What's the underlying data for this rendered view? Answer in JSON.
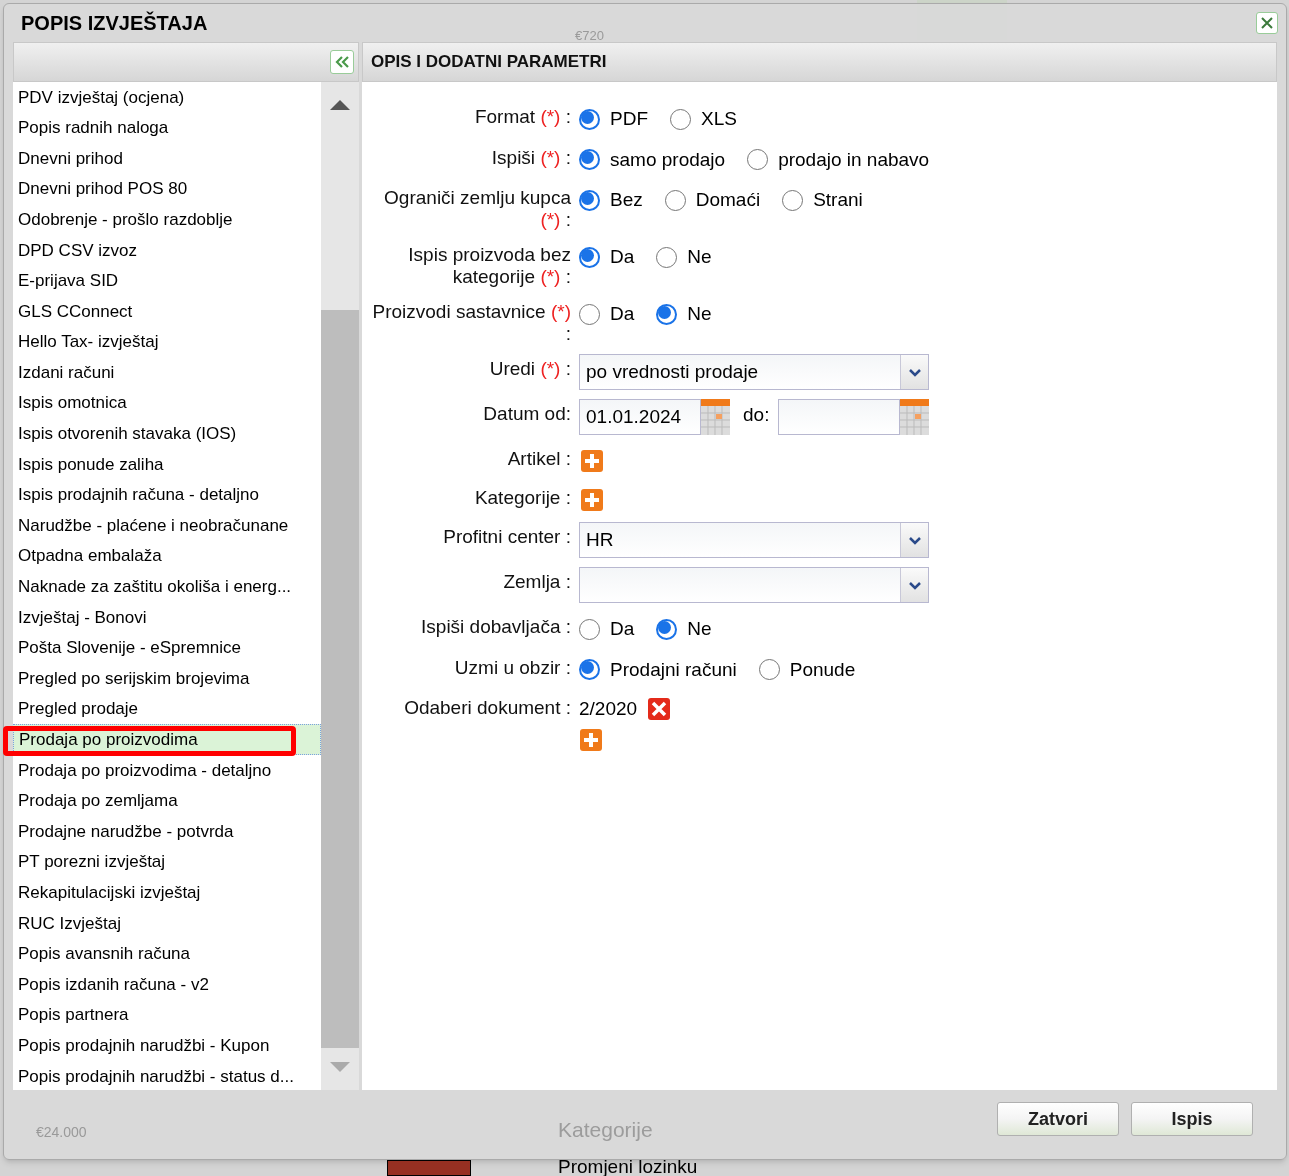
{
  "backdrop": {
    "top_value": "€720",
    "axis_label": "€24.000",
    "menu_items": [
      "Kategorije",
      "Promjeni lozinku"
    ]
  },
  "dialog": {
    "title": "POPIS IZVJEŠTAJA",
    "panel_title": "OPIS I DODATNI PARAMETRI"
  },
  "reports": [
    {
      "label": "PDV izvještaj (ocjena)",
      "selected": false,
      "annotated": false
    },
    {
      "label": "Popis radnih naloga",
      "selected": false,
      "annotated": false
    },
    {
      "label": "Dnevni prihod",
      "selected": false,
      "annotated": false
    },
    {
      "label": "Dnevni prihod POS 80",
      "selected": false,
      "annotated": false
    },
    {
      "label": "Odobrenje - prošlo razdoblje",
      "selected": false,
      "annotated": false
    },
    {
      "label": "DPD CSV izvoz",
      "selected": false,
      "annotated": false
    },
    {
      "label": "E-prijava SID",
      "selected": false,
      "annotated": false
    },
    {
      "label": "GLS CConnect",
      "selected": false,
      "annotated": false
    },
    {
      "label": "Hello Tax- izvještaj",
      "selected": false,
      "annotated": false
    },
    {
      "label": "Izdani računi",
      "selected": false,
      "annotated": false
    },
    {
      "label": "Ispis omotnica",
      "selected": false,
      "annotated": false
    },
    {
      "label": "Ispis otvorenih stavaka (IOS)",
      "selected": false,
      "annotated": false
    },
    {
      "label": "Ispis ponude zaliha",
      "selected": false,
      "annotated": false
    },
    {
      "label": "Ispis prodajnih računa - detaljno",
      "selected": false,
      "annotated": false
    },
    {
      "label": "Narudžbe - plaćene i neobračunane",
      "selected": false,
      "annotated": false
    },
    {
      "label": "Otpadna embalaža",
      "selected": false,
      "annotated": false
    },
    {
      "label": "Naknade za zaštitu okoliša i energ...",
      "selected": false,
      "annotated": false
    },
    {
      "label": "Izvještaj - Bonovi",
      "selected": false,
      "annotated": false
    },
    {
      "label": "Pošta Slovenije - eSpremnice",
      "selected": false,
      "annotated": false
    },
    {
      "label": "Pregled po serijskim brojevima",
      "selected": false,
      "annotated": false
    },
    {
      "label": "Pregled prodaje",
      "selected": false,
      "annotated": false
    },
    {
      "label": "Prodaja po proizvodima",
      "selected": true,
      "annotated": true
    },
    {
      "label": "Prodaja po proizvodima - detaljno",
      "selected": false,
      "annotated": false
    },
    {
      "label": "Prodaja po zemljama",
      "selected": false,
      "annotated": false
    },
    {
      "label": "Prodajne narudžbe - potvrda",
      "selected": false,
      "annotated": false
    },
    {
      "label": "PT porezni izvještaj",
      "selected": false,
      "annotated": false
    },
    {
      "label": "Rekapitulacijski izvještaj",
      "selected": false,
      "annotated": false
    },
    {
      "label": "RUC Izvještaj",
      "selected": false,
      "annotated": false
    },
    {
      "label": "Popis avansnih računa",
      "selected": false,
      "annotated": false
    },
    {
      "label": "Popis izdanih računa - v2",
      "selected": false,
      "annotated": false
    },
    {
      "label": "Popis partnera",
      "selected": false,
      "annotated": false
    },
    {
      "label": "Popis prodajnih narudžbi - Kupon",
      "selected": false,
      "annotated": false
    },
    {
      "label": "Popis prodajnih narudžbi - status d...",
      "selected": false,
      "annotated": false
    }
  ],
  "form": [
    {
      "kind": "radio",
      "label": "Format",
      "required_mark": "(*)",
      "suffix": ":",
      "options": [
        {
          "label": "PDF",
          "selected": true
        },
        {
          "label": "XLS",
          "selected": false
        }
      ]
    },
    {
      "kind": "radio",
      "label": "Ispiši",
      "required_mark": "(*)",
      "suffix": ":",
      "options": [
        {
          "label": "samo prodajo",
          "selected": true
        },
        {
          "label": "prodajo in nabavo",
          "selected": false
        }
      ]
    },
    {
      "kind": "radio",
      "label": "Ograniči zemlju kupca",
      "required_mark": "(*)",
      "suffix": ":",
      "options": [
        {
          "label": "Bez",
          "selected": true
        },
        {
          "label": "Domaći",
          "selected": false
        },
        {
          "label": "Strani",
          "selected": false
        }
      ]
    },
    {
      "kind": "radio",
      "label": "Ispis proizvoda bez kategorije",
      "required_mark": "(*)",
      "suffix": ":",
      "options": [
        {
          "label": "Da",
          "selected": true
        },
        {
          "label": "Ne",
          "selected": false
        }
      ]
    },
    {
      "kind": "radio",
      "label": "Proizvodi sastavnice",
      "required_mark": "(*)",
      "suffix": ":",
      "options": [
        {
          "label": "Da",
          "selected": false
        },
        {
          "label": "Ne",
          "selected": true
        }
      ]
    },
    {
      "kind": "select",
      "label": "Uredi",
      "required_mark": "(*)",
      "suffix": ":",
      "value": "po vrednosti prodaje"
    },
    {
      "kind": "date_range",
      "label": "Datum od:",
      "value": "01.01.2024",
      "to_label": "do:"
    },
    {
      "kind": "add",
      "label": "Artikel :"
    },
    {
      "kind": "add",
      "label": "Kategorije :"
    },
    {
      "kind": "select",
      "label": "Profitni center :",
      "value": "HR"
    },
    {
      "kind": "select",
      "label": "Zemlja :"
    },
    {
      "kind": "radio",
      "label": "Ispiši dobavljača :",
      "options": [
        {
          "label": "Da",
          "selected": false
        },
        {
          "label": "Ne",
          "selected": true
        }
      ]
    },
    {
      "kind": "radio",
      "label": "Uzmi u obzir :",
      "options": [
        {
          "label": "Prodajni računi",
          "selected": true
        },
        {
          "label": "Ponude",
          "selected": false
        }
      ]
    },
    {
      "kind": "document",
      "label": "Odaberi dokument :",
      "value": "2/2020"
    }
  ],
  "buttons": [
    "Zatvori",
    "Ispis"
  ]
}
